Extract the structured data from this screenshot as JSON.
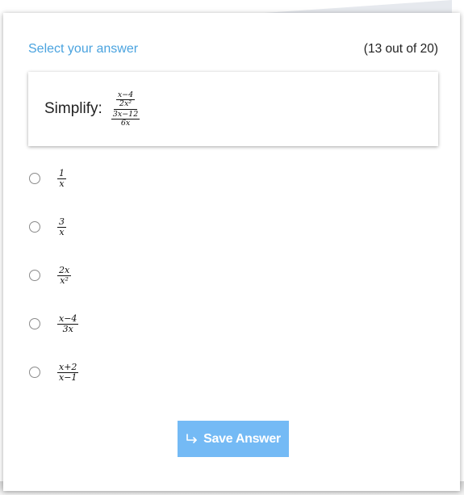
{
  "header": {
    "title": "Select your answer",
    "progress": "(13 out of 20)"
  },
  "question": {
    "prompt": "Simplify:",
    "expression": {
      "outer_numerator": {
        "numerator": "x−4",
        "denominator": "2x²"
      },
      "outer_denominator": {
        "numerator": "3x−12",
        "denominator": "6x"
      }
    }
  },
  "options": [
    {
      "numerator": "1",
      "denominator": "x"
    },
    {
      "numerator": "3",
      "denominator": "x"
    },
    {
      "numerator": "2x",
      "denominator": "x²"
    },
    {
      "numerator": "x−4",
      "denominator": "3x"
    },
    {
      "numerator": "x+2",
      "denominator": "x−1"
    }
  ],
  "save_button": {
    "label": "Save Answer",
    "icon": "enter-arrow-icon"
  },
  "colors": {
    "accent": "#4aa3df",
    "button": "#74baf5"
  }
}
